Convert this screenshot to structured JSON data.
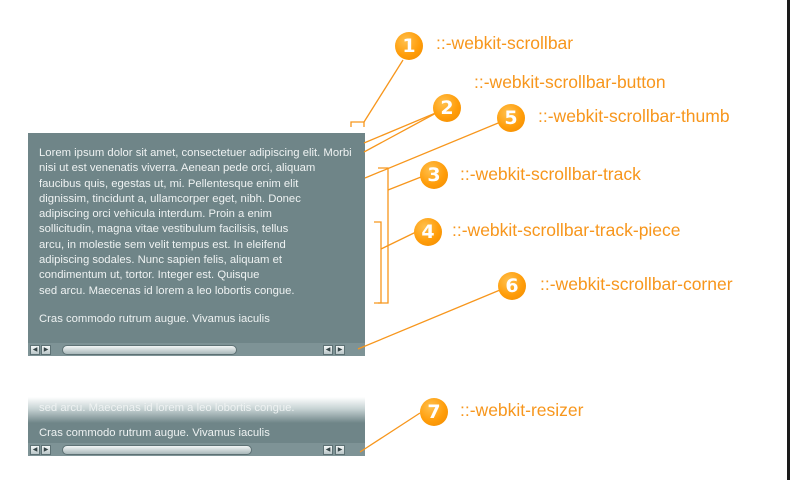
{
  "scrollbar_demo": {
    "text_lines": [
      "Lorem ipsum dolor sit amet, consectetuer adipiscing elit. Morbi",
      "nisi ut est venenatis viverra. Aenean pede orci, aliquam",
      "faucibus quis, egestas ut, mi. Pellentesque enim elit",
      "dignissim, tincidunt a, ullamcorper eget, nibh. Donec",
      "adipiscing orci vehicula interdum. Proin a enim",
      "sollicitudin, magna vitae vestibulum facilisis, tellus",
      "arcu, in molestie sem velit tempus est. In eleifend",
      "adipiscing sodales. Nunc sapien felis, aliquam et",
      "condimentum ut, tortor. Integer est. Quisque",
      "sed arcu. Maecenas id lorem a leo lobortis congue."
    ],
    "last_line": "Cras commodo rutrum augue. Vivamus iaculis"
  },
  "resizer_demo": {
    "text_lines": [
      "sed arcu. Maecenas id lorem a leo lobortis congue.",
      "Cras commodo rutrum augue. Vivamus iaculis"
    ]
  },
  "callouts": [
    {
      "number": "1",
      "label": "::-webkit-scrollbar"
    },
    {
      "number": "2",
      "label": "::-webkit-scrollbar-button"
    },
    {
      "number": "5",
      "label": "::-webkit-scrollbar-thumb"
    },
    {
      "number": "3",
      "label": "::-webkit-scrollbar-track"
    },
    {
      "number": "4",
      "label": "::-webkit-scrollbar-track-piece"
    },
    {
      "number": "6",
      "label": "::-webkit-scrollbar-corner"
    },
    {
      "number": "7",
      "label": "::-webkit-resizer"
    }
  ],
  "colors": {
    "accent": "#f7961c",
    "panel": "#6f8588",
    "scrollbar": "#7e9396"
  }
}
